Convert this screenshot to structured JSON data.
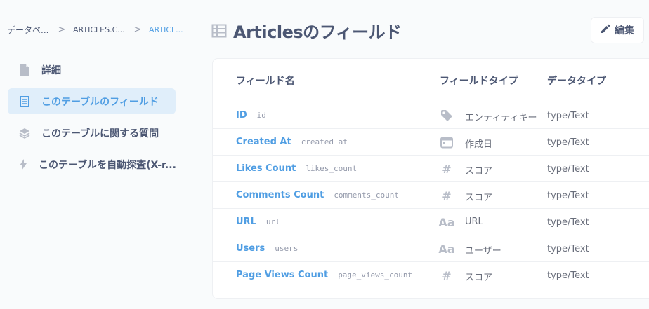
{
  "breadcrumb": {
    "items": [
      "データベ...",
      "ARTICLES.C...",
      "ARTICL..."
    ],
    "separator": ">"
  },
  "header": {
    "title": "Articlesのフィールド",
    "title_icon": "table-icon",
    "edit_label": "編集"
  },
  "sidebar": {
    "items": [
      {
        "label": "詳細",
        "icon": "document-icon",
        "active": false
      },
      {
        "label": "このテーブルのフィールド",
        "icon": "list-icon",
        "active": true
      },
      {
        "label": "このテーブルに関する質問",
        "icon": "stack-icon",
        "active": false
      },
      {
        "label": "このテーブルを自動探査(X-r...",
        "icon": "bolt-icon",
        "active": false
      }
    ]
  },
  "table": {
    "headers": {
      "name": "フィールド名",
      "field_type": "フィールドタイプ",
      "data_type": "データタイプ"
    },
    "rows": [
      {
        "display_name": "ID",
        "raw_name": "id",
        "type_icon": "tag-icon",
        "field_type": "エンティティキー",
        "data_type": "type/Text"
      },
      {
        "display_name": "Created At",
        "raw_name": "created_at",
        "type_icon": "calendar-icon",
        "field_type": "作成日",
        "data_type": "type/Text"
      },
      {
        "display_name": "Likes Count",
        "raw_name": "likes_count",
        "type_icon": "hash-icon",
        "field_type": "スコア",
        "data_type": "type/Text"
      },
      {
        "display_name": "Comments Count",
        "raw_name": "comments_count",
        "type_icon": "hash-icon",
        "field_type": "スコア",
        "data_type": "type/Text"
      },
      {
        "display_name": "URL",
        "raw_name": "url",
        "type_icon": "text-icon",
        "field_type": "URL",
        "data_type": "type/Text"
      },
      {
        "display_name": "Users",
        "raw_name": "users",
        "type_icon": "text-icon",
        "field_type": "ユーザー",
        "data_type": "type/Text"
      },
      {
        "display_name": "Page Views Count",
        "raw_name": "page_views_count",
        "type_icon": "hash-icon",
        "field_type": "スコア",
        "data_type": "type/Text"
      }
    ]
  },
  "colors": {
    "accent": "#509ee3",
    "text": "#4c5773",
    "muted": "#949aab",
    "active_bg": "#e0eefa"
  }
}
